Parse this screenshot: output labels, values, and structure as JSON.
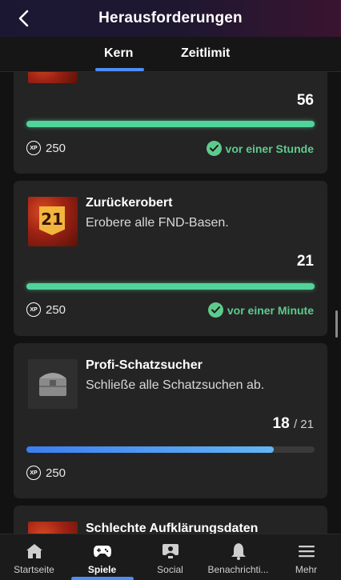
{
  "header": {
    "title": "Herausforderungen"
  },
  "tabs": [
    {
      "label": "Kern",
      "active": true
    },
    {
      "label": "Zeitlimit",
      "active": false
    }
  ],
  "challenges": [
    {
      "title": "",
      "description": "",
      "progress_value": "56",
      "progress_fraction": 1.0,
      "xp": "250",
      "completed_text": "vor einer Stunde",
      "badge_icon": "flame-badge-icon"
    },
    {
      "title": "Zurückerobert",
      "description": "Erobere alle FND-Basen.",
      "badge_number": "21",
      "progress_value": "21",
      "progress_fraction": 1.0,
      "xp": "250",
      "completed_text": "vor einer Minute",
      "badge_icon": "flag-badge-icon"
    },
    {
      "title": "Profi-Schatzsucher",
      "description": "Schließe alle Schatzsuchen ab.",
      "progress_value": "18",
      "progress_total": "/ 21",
      "progress_fraction": 0.857,
      "xp": "250",
      "badge_icon": "treasure-chest-icon"
    },
    {
      "title": "Schlechte Aufklärungsdaten",
      "badge_icon": "flame-badge-icon"
    }
  ],
  "xp_icon_label": "XP",
  "colors": {
    "accent": "#4f8df5",
    "complete_green": "#52d39a",
    "progress_blue": "#3c7ef0",
    "card_bg": "#242424",
    "page_bg": "#121212"
  },
  "bottom_nav": [
    {
      "label": "Startseite",
      "icon": "home-icon"
    },
    {
      "label": "Spiele",
      "icon": "gamepad-icon",
      "active": true
    },
    {
      "label": "Social",
      "icon": "social-icon"
    },
    {
      "label": "Benachrichti...",
      "icon": "bell-icon"
    },
    {
      "label": "Mehr",
      "icon": "menu-icon"
    }
  ]
}
